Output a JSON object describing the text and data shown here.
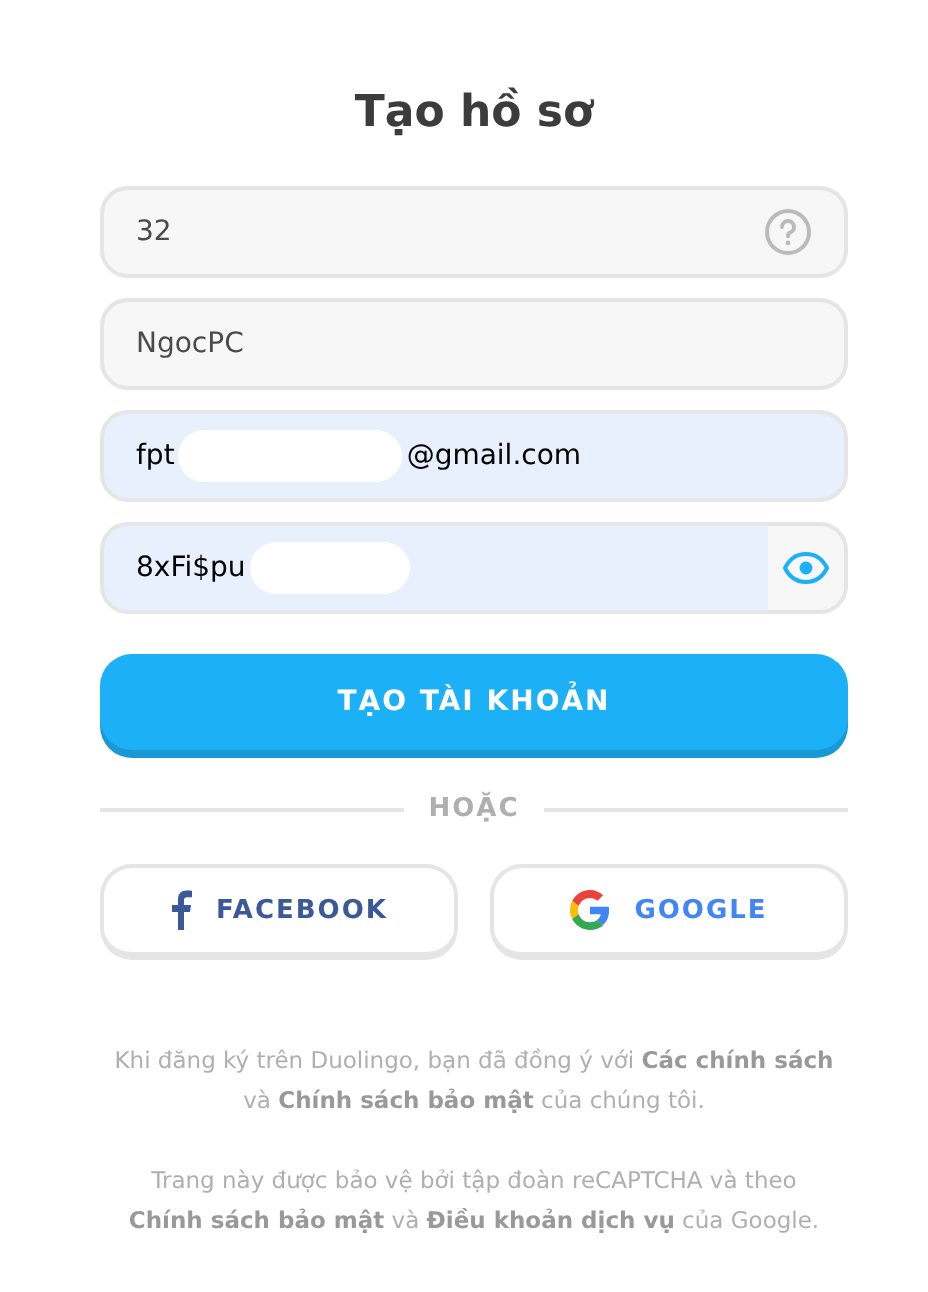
{
  "title": "Tạo hồ sơ",
  "fields": [
    {
      "kind": "age",
      "parts": [
        "32"
      ],
      "filled": false
    },
    {
      "kind": "text",
      "parts": [
        "NgocPC"
      ],
      "filled": false
    },
    {
      "kind": "email",
      "parts": [
        "fpt",
        "@gmail.com"
      ],
      "filled": true,
      "redacted": true
    },
    {
      "kind": "password",
      "parts": [
        "8xFi$pu"
      ],
      "filled": true,
      "redacted": true
    }
  ],
  "submit": "TẠO TÀI KHOẢN",
  "divider": "HOẶC",
  "social": [
    {
      "kind": "facebook",
      "label": "FACEBOOK"
    },
    {
      "kind": "google",
      "label": "GOOGLE"
    }
  ],
  "legal": [
    "Khi đăng ký trên Duolingo, bạn đã đồng ý với **Các chính sách** và **Chính sách bảo mật** của chúng tôi.",
    "Trang này được bảo vệ bởi tập đoàn reCAPTCHA và theo **Chính sách bảo mật** và **Điều khoản dịch vụ** của Google."
  ]
}
